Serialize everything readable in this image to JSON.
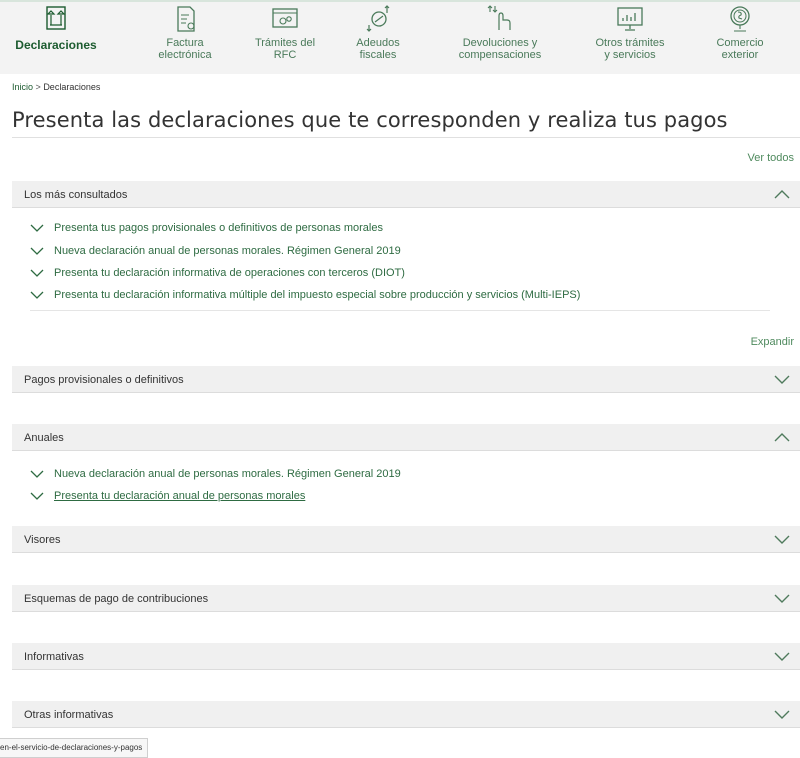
{
  "nav": {
    "items": [
      {
        "label": "Declaraciones",
        "icon": "declaraciones-icon",
        "active": true
      },
      {
        "label": "Factura\nelectrónica",
        "icon": "factura-icon"
      },
      {
        "label": "Trámites del\nRFC",
        "icon": "tramites-rfc-icon"
      },
      {
        "label": "Adeudos\nfiscales",
        "icon": "adeudos-icon"
      },
      {
        "label": "Devoluciones y\ncompensaciones",
        "icon": "devoluciones-icon"
      },
      {
        "label": "Otros trámites\ny servicios",
        "icon": "otros-tramites-icon"
      },
      {
        "label": "Comercio\nexterior",
        "icon": "comercio-exterior-icon"
      }
    ]
  },
  "breadcrumb": {
    "home": "Inicio",
    "separator": ">",
    "current": "Declaraciones"
  },
  "page_title": "Presenta las declaraciones que te corresponden y realiza tus pagos",
  "ver_todos": "Ver todos",
  "expandir": "Expandir",
  "panels": {
    "mas_consultados": {
      "title": "Los más consultados",
      "expanded": true,
      "items": [
        "Presenta tus pagos provisionales o definitivos de personas morales",
        "Nueva declaración anual de personas morales. Régimen General 2019",
        "Presenta tu declaración informativa de operaciones con terceros (DIOT)",
        "Presenta tu declaración informativa múltiple del impuesto especial sobre producción y servicios (Multi-IEPS)"
      ]
    },
    "pagos": {
      "title": "Pagos provisionales o definitivos",
      "expanded": false
    },
    "anuales": {
      "title": "Anuales",
      "expanded": true,
      "items": [
        "Nueva declaración anual de personas morales. Régimen General 2019",
        "Presenta tu declaración anual de personas morales"
      ]
    },
    "visores": {
      "title": "Visores",
      "expanded": false
    },
    "esquemas": {
      "title": "Esquemas de pago de contribuciones",
      "expanded": false
    },
    "informativas": {
      "title": "Informativas",
      "expanded": false
    },
    "otras": {
      "title": "Otras informativas",
      "expanded": false
    }
  },
  "status_url": "en-el-servicio-de-declaraciones-y-pagos",
  "colors": {
    "brand": "#1c5b2f",
    "link": "#2e6b42",
    "panel_bg": "#f0f0f0"
  }
}
